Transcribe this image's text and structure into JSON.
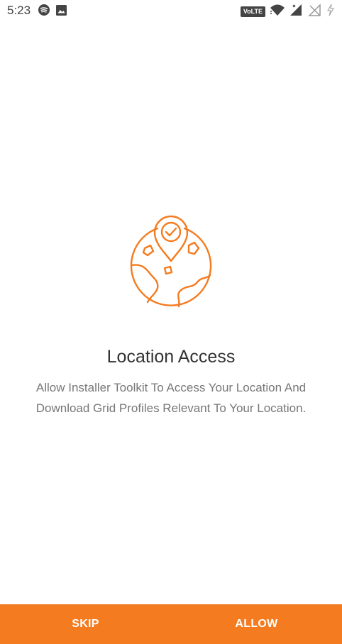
{
  "status_bar": {
    "time": "5:23",
    "left_icons": [
      "spotify-icon",
      "image-icon"
    ],
    "right_icons": [
      "volte-badge",
      "wifi-icon",
      "signal-icon",
      "no-sim-icon",
      "battery-charging-icon"
    ],
    "volte_label": "VoLTE"
  },
  "onboarding": {
    "icon": "location-globe-icon",
    "title": "Location Access",
    "description": "Allow Installer Toolkit To Access Your Location And Download Grid Profiles Relevant To Your Location."
  },
  "actions": {
    "skip_label": "SKIP",
    "allow_label": "ALLOW"
  },
  "colors": {
    "accent": "#F47B20",
    "background": "#FFFFFF",
    "title_text": "#333333",
    "body_text": "#777777"
  }
}
